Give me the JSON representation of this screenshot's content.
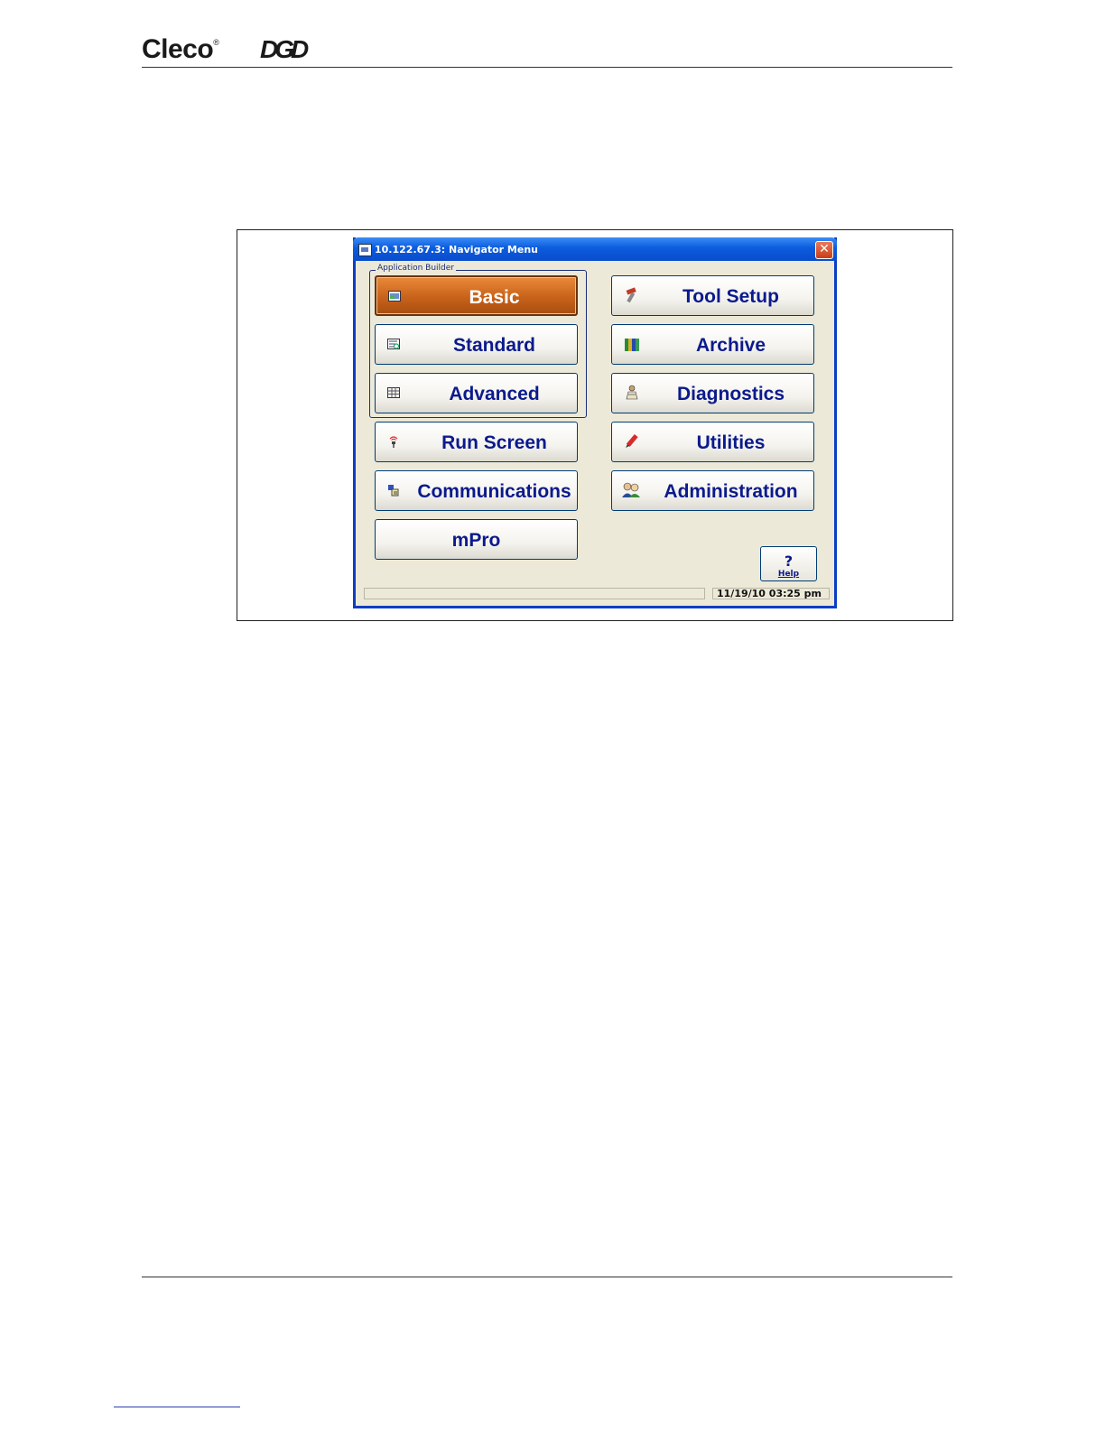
{
  "page": {
    "brand_name": "Cleco",
    "brand_mark": "®",
    "product_logo": "DGD"
  },
  "window": {
    "title": "10.122.67.3: Navigator Menu",
    "close_glyph": "✕"
  },
  "group": {
    "label": "Application Builder"
  },
  "buttons": {
    "basic": "Basic",
    "standard": "Standard",
    "advanced": "Advanced",
    "run_screen": "Run Screen",
    "communications": "Communications",
    "mpro": "mPro",
    "tool_setup": "Tool Setup",
    "archive": "Archive",
    "diagnostics": "Diagnostics",
    "utilities": "Utilities",
    "administration": "Administration"
  },
  "help": {
    "glyph": "?",
    "label": "Help"
  },
  "status": {
    "left_text": "",
    "datetime": "11/19/10 03:25 pm"
  },
  "colors": {
    "active_button": "#c8621a",
    "button_text": "#0b1a8c",
    "title_bar": "#0b5cde",
    "window_bg": "#ece9d8"
  },
  "icons": {
    "basic": "form-icon",
    "standard": "form-list-icon",
    "advanced": "grid-icon",
    "run_screen": "antenna-icon",
    "communications": "network-icon",
    "tool_setup": "wrench-icon",
    "archive": "binders-icon",
    "diagnostics": "technician-icon",
    "utilities": "pen-icon",
    "administration": "users-icon"
  }
}
